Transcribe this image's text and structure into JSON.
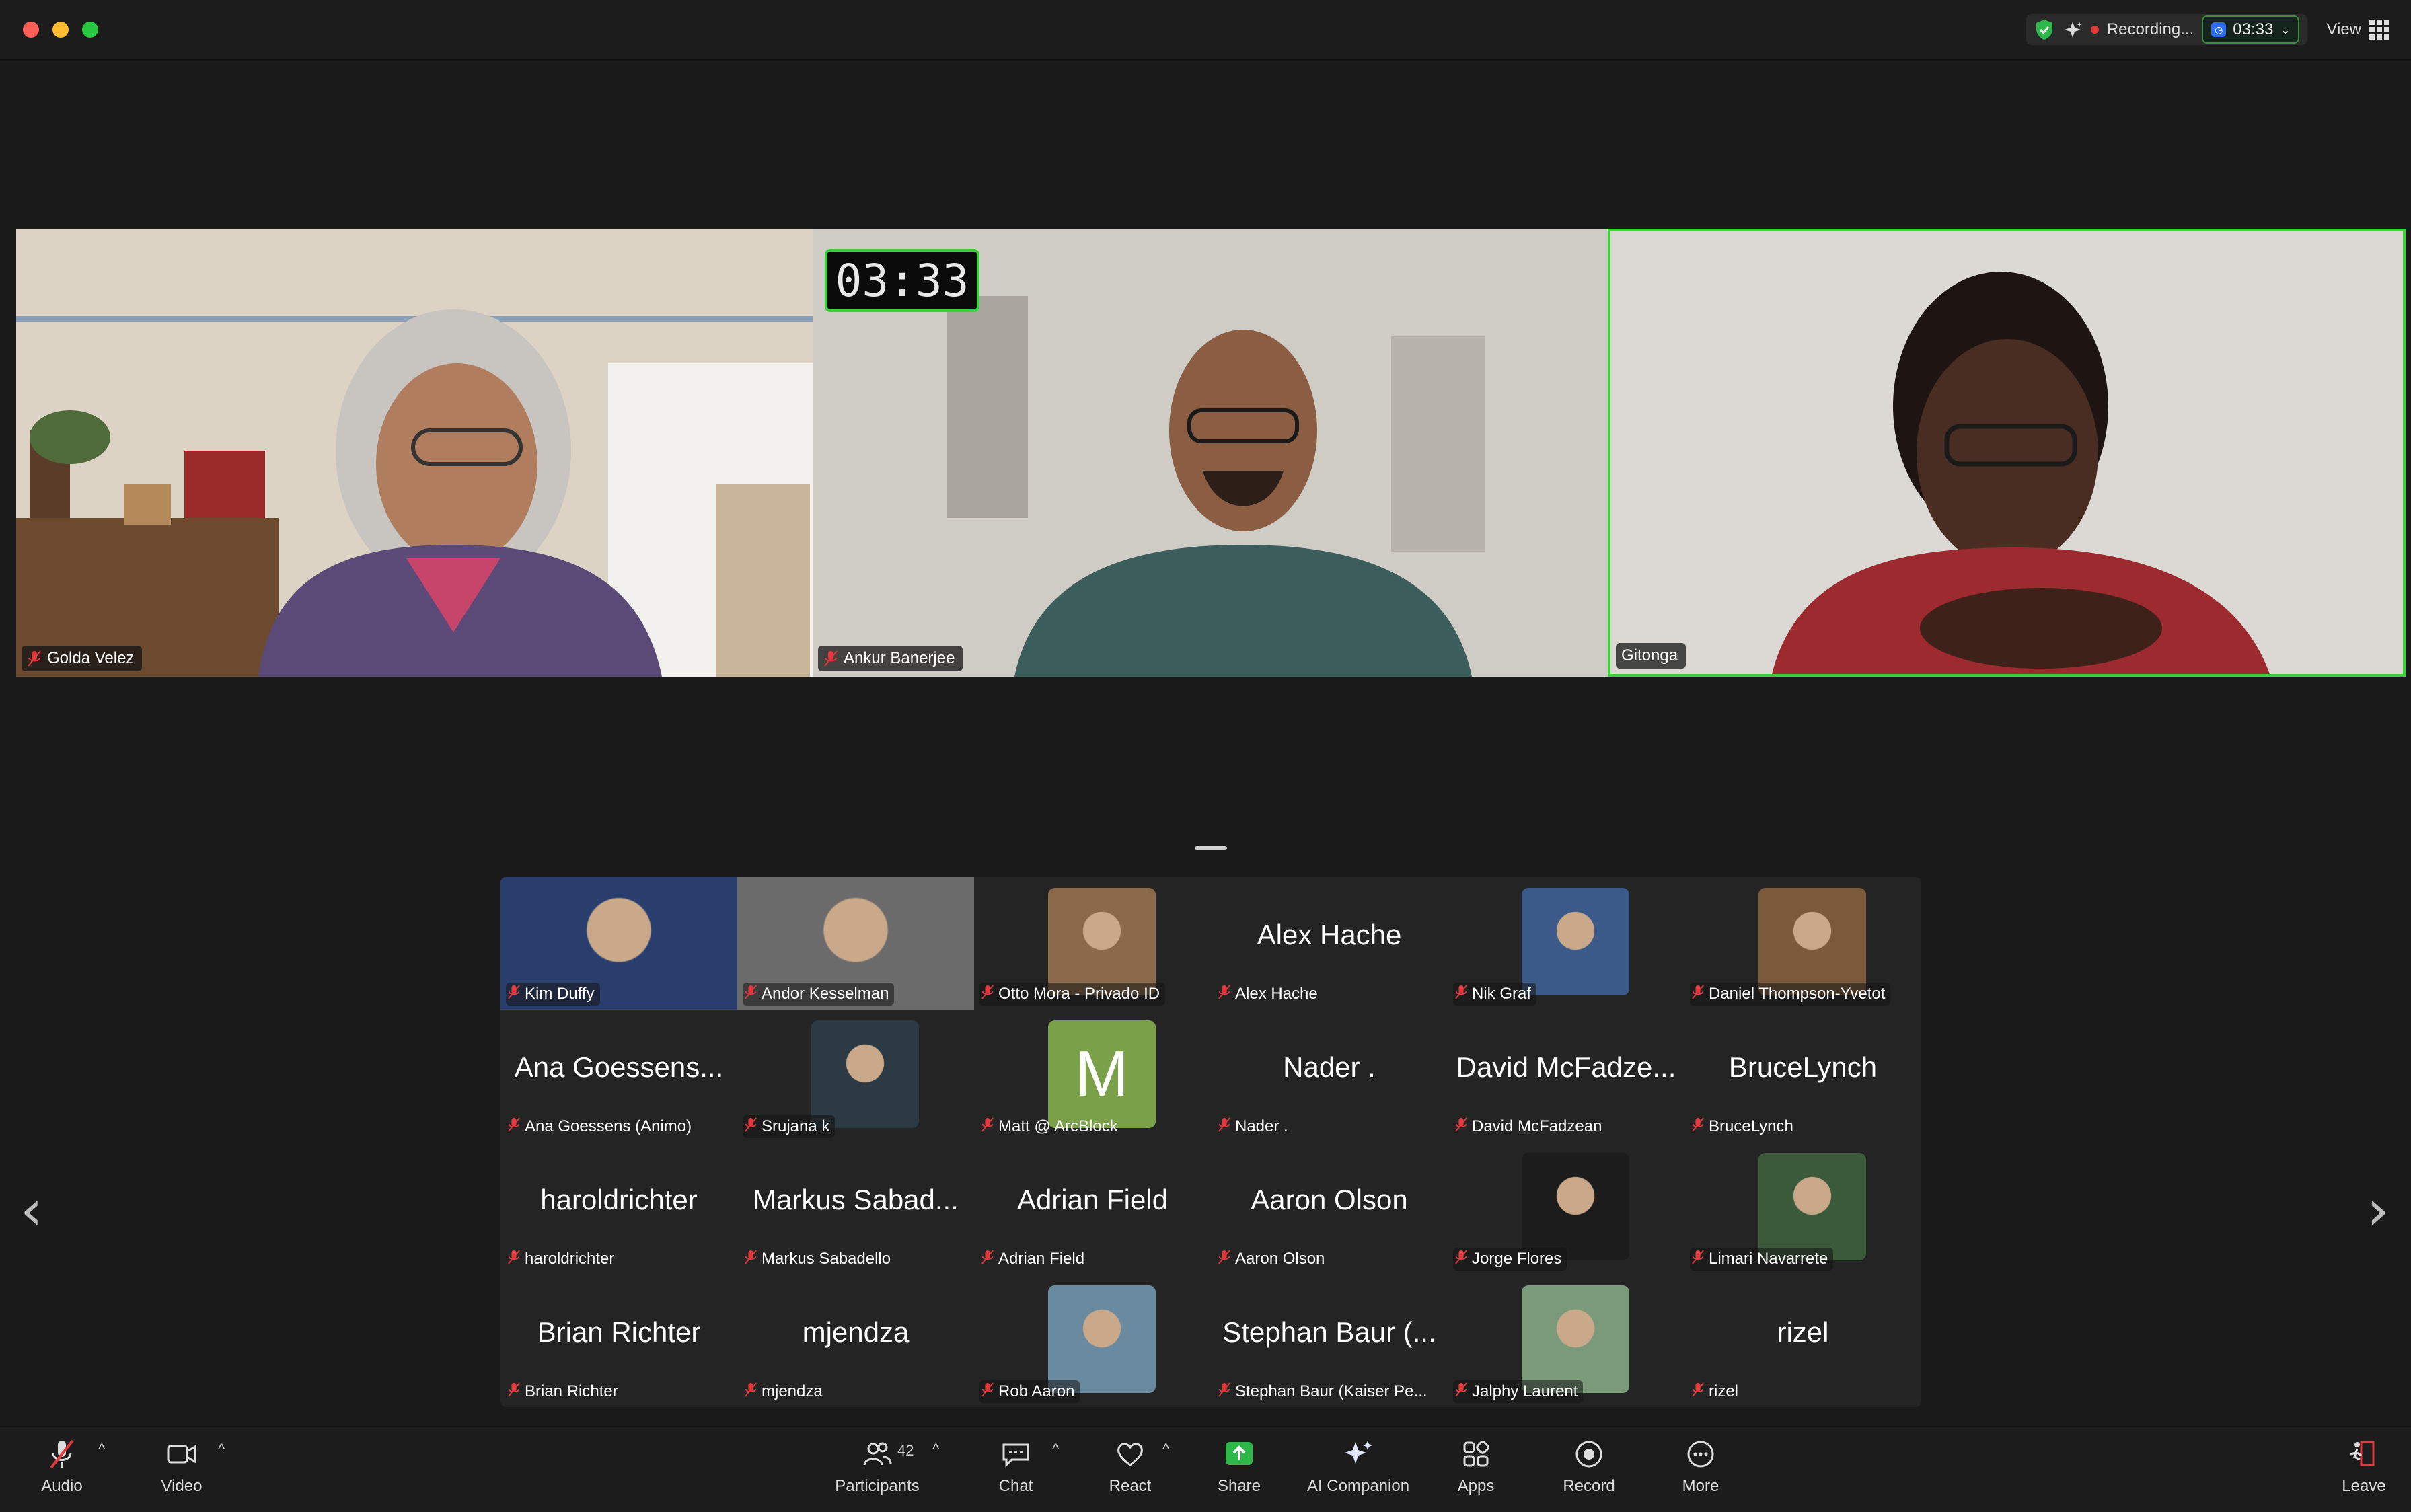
{
  "titlebar": {
    "recording_label": "Recording...",
    "timer": "03:33",
    "view_label": "View"
  },
  "spotlight": [
    {
      "name": "Golda Velez"
    },
    {
      "name": "Ankur Banerjee",
      "timer": "03:33"
    },
    {
      "name": "Gitonga"
    }
  ],
  "gallery": [
    {
      "name": "Kim Duffy",
      "big": ""
    },
    {
      "name": "Andor Kesselman",
      "big": ""
    },
    {
      "name": "Otto Mora - Privado ID",
      "big": ""
    },
    {
      "name": "Alex Hache",
      "big": "Alex Hache"
    },
    {
      "name": "Nik Graf",
      "big": ""
    },
    {
      "name": "Daniel Thompson-Yvetot",
      "big": ""
    },
    {
      "name": "Ana Goessens (Animo)",
      "big": "Ana Goessens..."
    },
    {
      "name": "Srujana k",
      "big": ""
    },
    {
      "name": "Matt @ ArcBlock",
      "big": "",
      "avatar_letter": "M"
    },
    {
      "name": "Nader .",
      "big": "Nader ."
    },
    {
      "name": "David McFadzean",
      "big": "David McFadze..."
    },
    {
      "name": "BruceLynch",
      "big": "BruceLynch"
    },
    {
      "name": "haroldrichter",
      "big": "haroldrichter"
    },
    {
      "name": "Markus Sabadello",
      "big": "Markus Sabad..."
    },
    {
      "name": "Adrian Field",
      "big": "Adrian Field"
    },
    {
      "name": "Aaron Olson",
      "big": "Aaron Olson"
    },
    {
      "name": "Jorge Flores",
      "big": ""
    },
    {
      "name": "Limari Navarrete",
      "big": ""
    },
    {
      "name": "Brian Richter",
      "big": "Brian Richter"
    },
    {
      "name": "mjendza",
      "big": "mjendza"
    },
    {
      "name": "Rob Aaron",
      "big": ""
    },
    {
      "name": "Stephan Baur (Kaiser Pe...",
      "big": "Stephan Baur (..."
    },
    {
      "name": "Jalphy Laurent",
      "big": ""
    },
    {
      "name": "rizel",
      "big": "rizel"
    }
  ],
  "toolbar": {
    "audio": "Audio",
    "video": "Video",
    "participants": "Participants",
    "participants_count": "42",
    "chat": "Chat",
    "react": "React",
    "share": "Share",
    "ai_companion": "AI Companion",
    "apps": "Apps",
    "record": "Record",
    "more": "More",
    "leave": "Leave"
  },
  "colors": {
    "active_speaker_border": "#3ad13a",
    "share_green": "#2fb84a",
    "mute_red": "#e0393e",
    "leave_red": "#e0393e"
  }
}
